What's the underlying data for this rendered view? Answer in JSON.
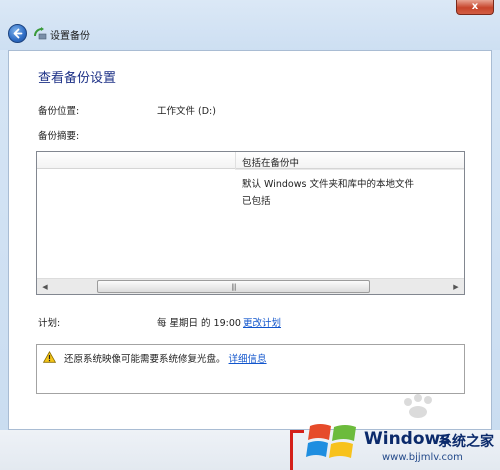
{
  "window": {
    "title": "设置备份",
    "close_label": "x"
  },
  "page": {
    "heading": "查看备份设置",
    "location_label": "备份位置:",
    "location_value": "工作文件 (D:)",
    "summary_label": "备份摘要:",
    "schedule_label": "计划:",
    "schedule_value": "每 星期日 的 19:00",
    "change_schedule_link": "更改计划"
  },
  "summary_table": {
    "column_header": "包括在备份中",
    "rows": [
      "默认 Windows 文件夹和库中的本地文件",
      "已包括"
    ]
  },
  "scrollbar": {
    "left_arrow": "◀",
    "right_arrow": "▶",
    "grip": "|||"
  },
  "warning": {
    "text": "还原系统映像可能需要系统修复光盘。",
    "link": "详细信息"
  },
  "watermark": {
    "brand": "Windows",
    "suffix": "系统之家",
    "url": "www.bjjmlv.com"
  },
  "colors": {
    "heading": "#1e3287",
    "link": "#1155cc",
    "chrome": "#cddff2"
  },
  "icons": {
    "back": "back-arrow-icon",
    "title": "backup-icon",
    "warning": "warning-icon",
    "logo": "windows-logo-icon"
  }
}
